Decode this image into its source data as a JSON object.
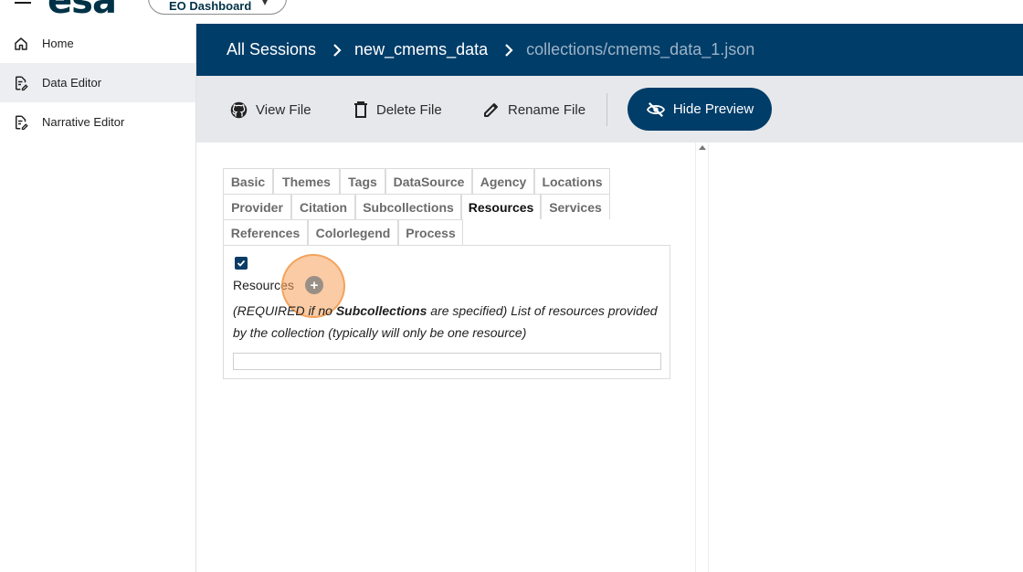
{
  "topbar": {
    "logo_text": "esa",
    "dashboard_label": "EO Dashboard"
  },
  "sidebar": {
    "items": [
      {
        "label": "Home",
        "icon": "home-icon"
      },
      {
        "label": "Data Editor",
        "icon": "edit-document-icon",
        "active": true
      },
      {
        "label": "Narrative Editor",
        "icon": "edit-document-icon"
      }
    ]
  },
  "breadcrumb": {
    "items": [
      "All Sessions",
      "new_cmems_data",
      "collections/cmems_data_1.json"
    ]
  },
  "toolbar": {
    "view_file": "View File",
    "delete_file": "Delete File",
    "rename_file": "Rename File",
    "hide_preview": "Hide Preview"
  },
  "editor": {
    "tabs": [
      "Basic",
      "Themes",
      "Tags",
      "DataSource",
      "Agency",
      "Locations",
      "Provider",
      "Citation",
      "Subcollections",
      "Resources",
      "Services",
      "References",
      "Colorlegend",
      "Process"
    ],
    "active_tab": "Resources",
    "field_label": "Resources",
    "add_symbol": "+",
    "desc_part1": "(REQUIRED if no ",
    "desc_bold": "Subcollections",
    "desc_part2": " are specified) List of resources provided by the collection (typically will only be one resource)",
    "checkbox_checked": true,
    "resources_value": ""
  },
  "colors": {
    "header_bg": "#003d69",
    "toolbar_bg": "#e6e8eb",
    "accent": "#003d69",
    "highlight": "#f5a05a"
  }
}
